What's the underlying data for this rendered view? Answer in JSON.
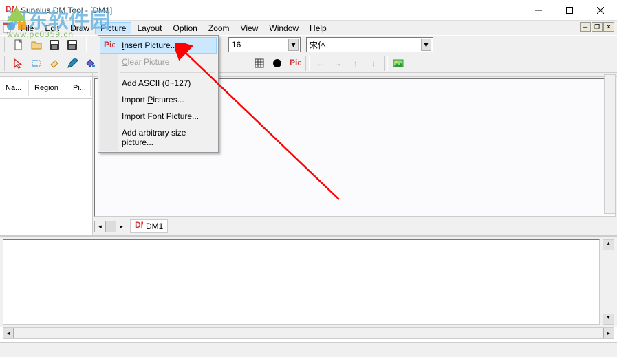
{
  "window": {
    "title": "Sunplus DM Tool - [DM1]"
  },
  "menubar": {
    "file": "File",
    "edit": "Edit",
    "draw": "Draw",
    "picture": "Picture",
    "layout": "Layout",
    "option": "Option",
    "zoom": "Zoom",
    "view": "View",
    "window": "Window",
    "help": "Help"
  },
  "picture_menu": {
    "insert": "Insert Picture...",
    "clear": "Clear Picture",
    "add_ascii": "Add ASCII (0~127)",
    "import_pics": "Import Pictures...",
    "import_font": "Import Font Picture...",
    "add_arbitrary": "Add arbitrary size picture..."
  },
  "toolbar": {
    "combo1": "16",
    "combo2": "宋体"
  },
  "left_header": {
    "name": "Na...",
    "region": "Region",
    "pi": "Pi..."
  },
  "canvas_tab": {
    "label": "DM1"
  },
  "watermark": {
    "line1": "河东软件园",
    "line2": "www.pc0359.cn"
  }
}
